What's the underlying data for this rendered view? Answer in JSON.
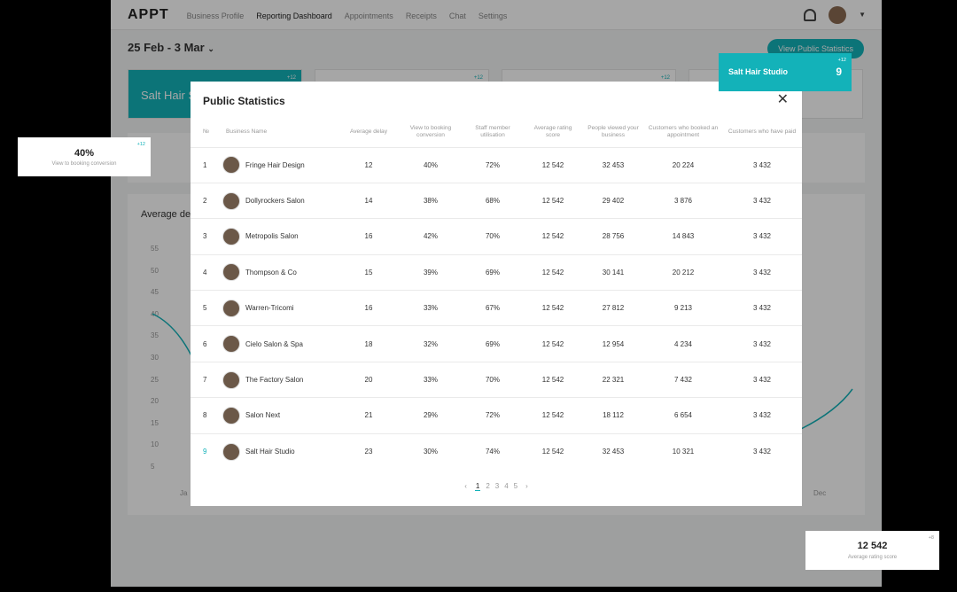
{
  "app": {
    "logo": "APPT",
    "nav": [
      "Business Profile",
      "Reporting Dashboard",
      "Appointments",
      "Receipts",
      "Chat",
      "Settings"
    ],
    "active_nav": "Reporting Dashboard",
    "date_range": "25 Feb - 3 Mar",
    "view_stats_button": "View Public Statistics",
    "card_title": "Salt Hair S",
    "card_delta": "+12",
    "chart_title": "Average del",
    "y_ticks": [
      "55",
      "50",
      "45",
      "40",
      "35",
      "30",
      "25",
      "20",
      "15",
      "10",
      "5"
    ],
    "x_first": "Ja",
    "x_last": "Dec"
  },
  "modal": {
    "title": "Public Statistics",
    "columns": [
      "№",
      "Business Name",
      "Average delay",
      "View to booking conversion",
      "Staff member utilisation",
      "Average rating score",
      "People viewed your business",
      "Customers who booked an appointment",
      "Customers who have paid"
    ],
    "rows": [
      {
        "rank": "1",
        "name": "Fringe Hair Design",
        "delay": "12",
        "conv": "40%",
        "util": "72%",
        "rating": "12 542",
        "viewed": "32 453",
        "booked": "20 224",
        "paid": "3 432"
      },
      {
        "rank": "2",
        "name": "Dollyrockers Salon",
        "delay": "14",
        "conv": "38%",
        "util": "68%",
        "rating": "12 542",
        "viewed": "29 402",
        "booked": "3 876",
        "paid": "3 432"
      },
      {
        "rank": "3",
        "name": "Metropolis Salon",
        "delay": "16",
        "conv": "42%",
        "util": "70%",
        "rating": "12 542",
        "viewed": "28 756",
        "booked": "14 843",
        "paid": "3 432"
      },
      {
        "rank": "4",
        "name": "Thompson & Co",
        "delay": "15",
        "conv": "39%",
        "util": "69%",
        "rating": "12 542",
        "viewed": "30 141",
        "booked": "20 212",
        "paid": "3 432"
      },
      {
        "rank": "5",
        "name": "Warren-Tricomi",
        "delay": "16",
        "conv": "33%",
        "util": "67%",
        "rating": "12 542",
        "viewed": "27 812",
        "booked": "9 213",
        "paid": "3 432"
      },
      {
        "rank": "6",
        "name": "Cielo Salon & Spa",
        "delay": "18",
        "conv": "32%",
        "util": "69%",
        "rating": "12 542",
        "viewed": "12 954",
        "booked": "4 234",
        "paid": "3 432"
      },
      {
        "rank": "7",
        "name": "The Factory Salon",
        "delay": "20",
        "conv": "33%",
        "util": "70%",
        "rating": "12 542",
        "viewed": "22 321",
        "booked": "7 432",
        "paid": "3 432"
      },
      {
        "rank": "8",
        "name": "Salon Next",
        "delay": "21",
        "conv": "29%",
        "util": "72%",
        "rating": "12 542",
        "viewed": "18 112",
        "booked": "6 654",
        "paid": "3 432"
      },
      {
        "rank": "9",
        "name": "Salt Hair Studio",
        "delay": "23",
        "conv": "30%",
        "util": "74%",
        "rating": "12 542",
        "viewed": "32 453",
        "booked": "10 321",
        "paid": "3 432",
        "highlight": true
      }
    ],
    "pages": [
      "1",
      "2",
      "3",
      "4",
      "5"
    ],
    "current_page": "1",
    "prev_label": "‹",
    "next_label": "›"
  },
  "float_conversion": {
    "value": "40%",
    "label": "View to booking conversion",
    "delta": "+12"
  },
  "float_salt": {
    "name": "Salt Hair Studio",
    "value": "9",
    "delta": "+12"
  },
  "float_rating": {
    "value": "12 542",
    "label": "Average rating score",
    "delta": "+8"
  }
}
